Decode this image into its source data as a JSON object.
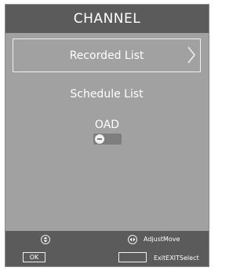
{
  "menu": {
    "title": "CHANNEL",
    "items": [
      {
        "label": "Recorded List",
        "selected": true,
        "has_submenu": true
      },
      {
        "label": "Schedule List",
        "selected": false
      }
    ],
    "oad": {
      "label": "OAD",
      "state": "off"
    }
  },
  "footer": {
    "ok_label": "OK",
    "adjust_label": "AdjustMove",
    "exit_label": "ExitEXITSelect"
  },
  "colors": {
    "panel": "#a1a1a1",
    "title_bar": "#5b5b5b",
    "footer_bar": "#5b5b5b",
    "text": "#ffffff"
  }
}
